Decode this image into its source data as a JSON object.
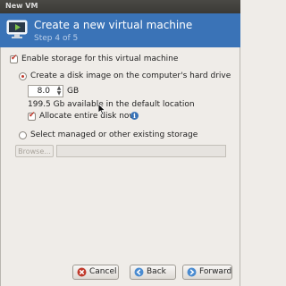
{
  "window": {
    "title": "New VM"
  },
  "header": {
    "title": "Create a new virtual machine",
    "step": "Step 4 of 5"
  },
  "storage": {
    "enable_label": "Enable storage for this virtual machine",
    "enable_checked": true,
    "create_option_label": "Create a disk image on the computer's hard drive",
    "size_value": "8.0",
    "size_unit": "GB",
    "available_text": "199.5 Gb available in the default location",
    "allocate_label": "Allocate entire disk now",
    "allocate_checked": true,
    "managed_option_label": "Select managed or other existing storage",
    "browse_label": "Browse...",
    "path_value": ""
  },
  "buttons": {
    "cancel": "Cancel",
    "back": "Back",
    "forward": "Forward"
  },
  "colors": {
    "header_bg": "#3a73b7",
    "accent_red": "#c0392b"
  },
  "icons": {
    "header": "vm-monitor-icon",
    "info": "info-icon",
    "cancel": "cancel-x-icon",
    "back": "back-arrow-icon",
    "forward": "forward-arrow-icon"
  }
}
